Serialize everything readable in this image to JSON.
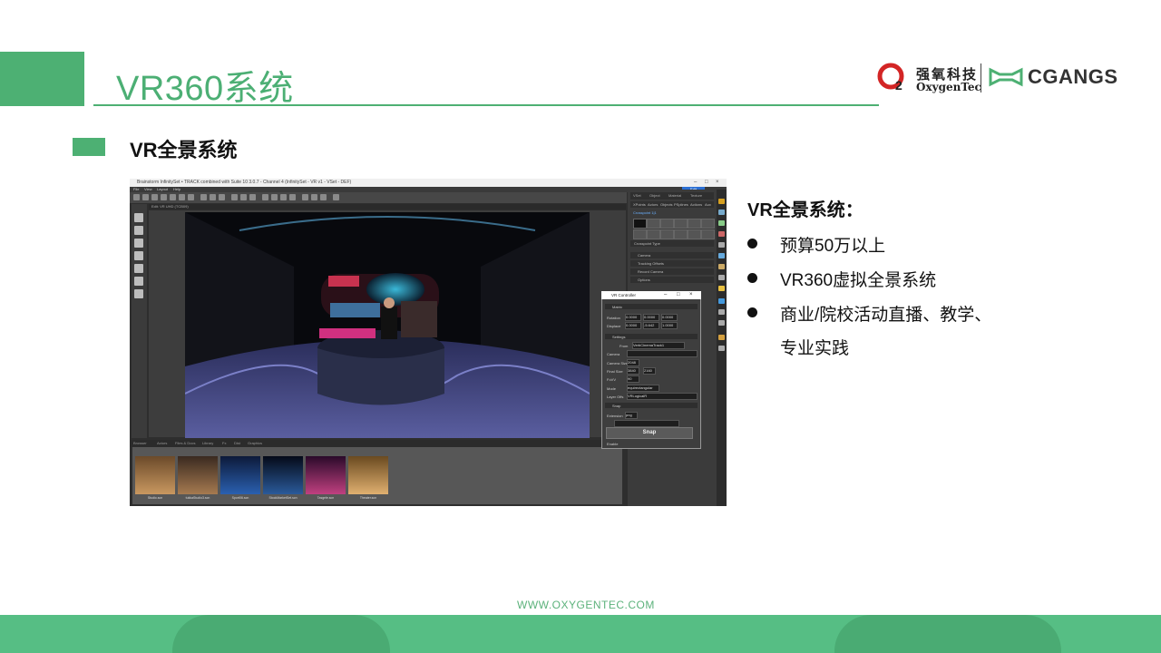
{
  "header": {
    "title": "VR360系统",
    "logo_cn": "强氧科技",
    "logo_en": "OxygenTec",
    "logo_brand": "CGANGS"
  },
  "section": {
    "title": "VR全景系统"
  },
  "details": {
    "title": "VR全景系统：",
    "bullets": [
      "预算50万以上",
      "VR360虚拟全景系统",
      "商业/院校活动直播、教学、"
    ],
    "continuation": "专业实践"
  },
  "footer": {
    "url": "WWW.OXYGENTEC.COM"
  },
  "colors": {
    "accent": "#4db073",
    "footer": "#56be84"
  },
  "screenshot": {
    "window_title": "Brainstorm InfinitySet • TRACK combined with Suite 10 3.0.7 - Channel 4 (InfinitySet - VR v1 - VSet - DEF)",
    "menus": [
      "File",
      "View",
      "Layout",
      "Help"
    ],
    "viewport_label": "Edit: VR UHD (TCB09)",
    "edit_button": "Edit",
    "browser_tabs": [
      "Browser",
      "Actors",
      "Files & Docs",
      "Library",
      "Fx",
      "Dist",
      "Graphics"
    ],
    "thumbnails": [
      "Studio.scn",
      "tukkaStudio3.scn",
      "Sport06.scn",
      "StockMarketSet.scn",
      "Tasgele.scn",
      "Theater.scn"
    ],
    "right_tabs": [
      "VSet",
      "Object",
      "Material",
      "Texture"
    ],
    "right_subtabs": [
      "XPoints",
      "Actors",
      "Objects",
      "PSplines",
      "Actions",
      "Aux"
    ],
    "right_rows": [
      "Crosspoint Type",
      "Camera",
      "Tracking Offsets",
      "Record Camera",
      "Options"
    ],
    "crosspoint_label": "Crosspoint 1|1",
    "vr_controller": {
      "title": "VR Controller",
      "sections": [
        "Matrix",
        "Settings",
        "Snap"
      ],
      "rotation_label": "Rotation",
      "rotation": [
        "0.0000",
        "0.0000",
        "0.0000"
      ],
      "displace_label": "Displace",
      "displace": [
        "0.0000",
        "-5.642",
        "1.0000"
      ],
      "from_label": "From",
      "from_value": "VerbCinemaTrack1",
      "camera_label": "Camera",
      "camera_size_label": "Camera Size",
      "camera_size": "2048",
      "final_size_label": "Final Size",
      "final_size": [
        "3840",
        "2160"
      ],
      "fov_label": "FoVV",
      "fov": "90",
      "mode_label": "Mode",
      "mode": "equirectangular",
      "layer_label": "Layer Offs",
      "layer": "VRLogicalR",
      "extension_label": "Extension",
      "extension": "png",
      "snap_button": "Snap",
      "enable_label": "Enable"
    }
  }
}
